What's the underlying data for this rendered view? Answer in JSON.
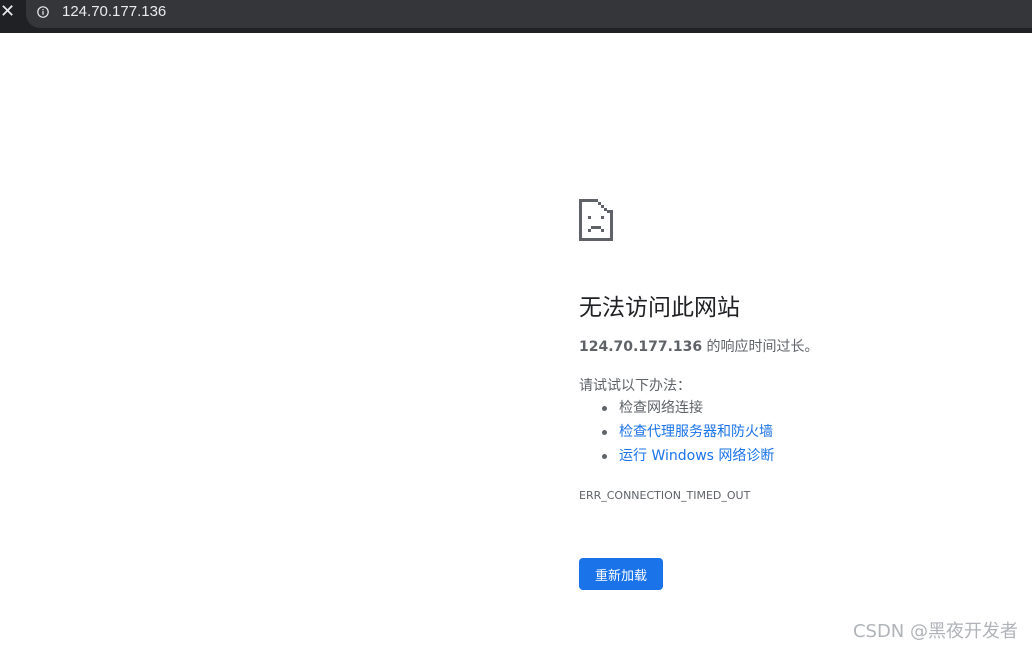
{
  "toolbar": {
    "stop_icon": "close-icon",
    "site_info_icon": "info-icon",
    "url": "124.70.177.136"
  },
  "error_page": {
    "icon": "sad-document-icon",
    "title": "无法访问此网站",
    "host": "124.70.177.136",
    "description_suffix": " 的响应时间过长。",
    "try_label": "请试试以下办法：",
    "suggestions": [
      {
        "label": "检查网络连接",
        "is_link": false
      },
      {
        "label": "检查代理服务器和防火墙",
        "is_link": true
      },
      {
        "label": "运行 Windows 网络诊断",
        "is_link": true
      }
    ],
    "error_code": "ERR_CONNECTION_TIMED_OUT",
    "reload_label": "重新加载"
  },
  "watermark": "CSDN @黑夜开发者",
  "colors": {
    "toolbar_bg": "#202124",
    "omnibox_bg": "#35363a",
    "link": "#1a73e8",
    "button": "#1a73e8",
    "text": "#202124",
    "secondary_text": "#5f6368"
  }
}
